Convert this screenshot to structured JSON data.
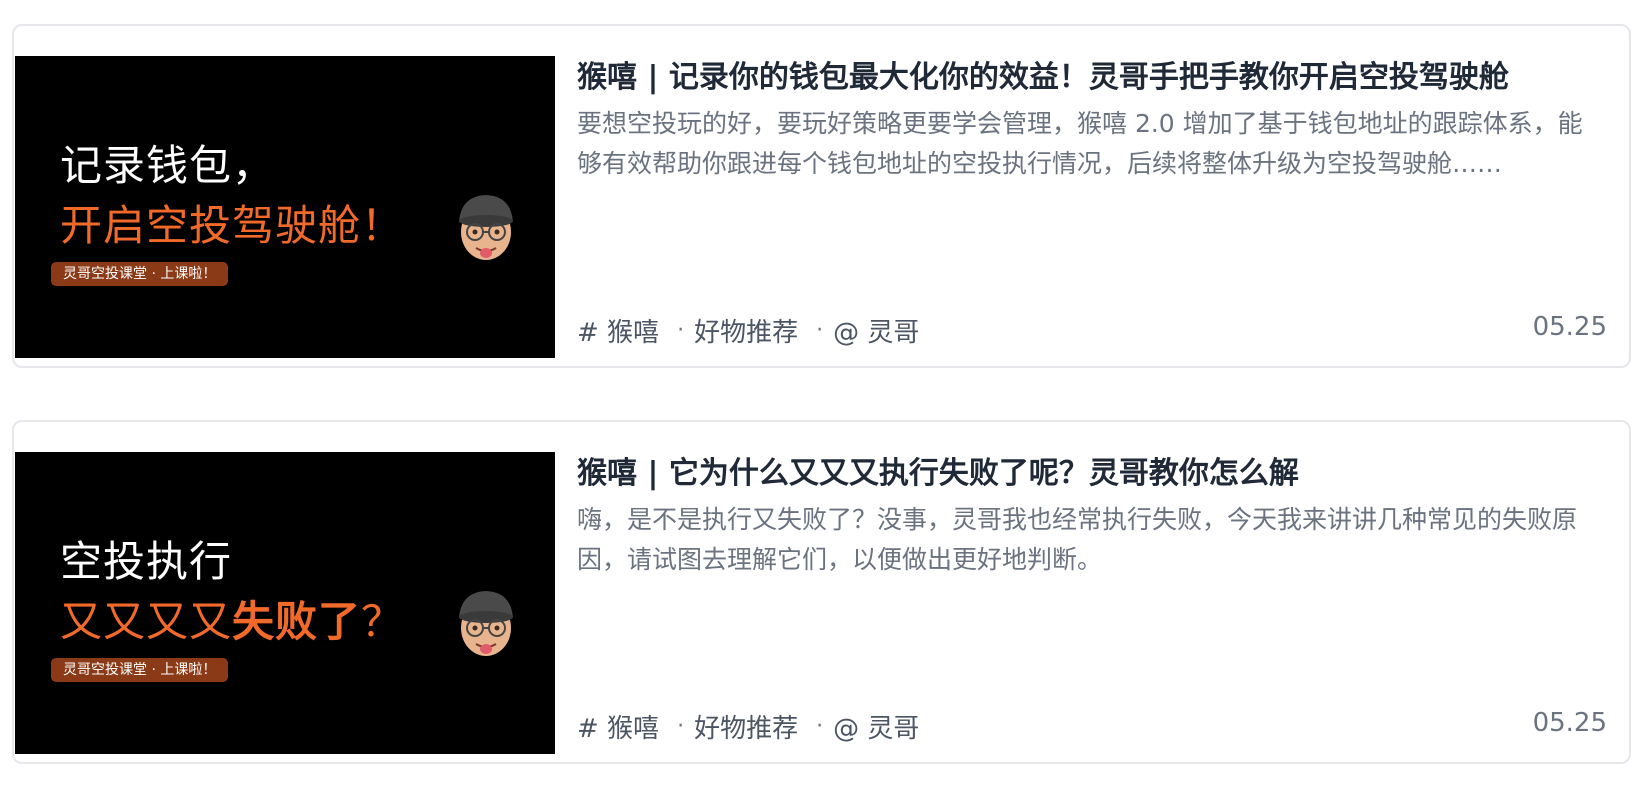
{
  "articles": [
    {
      "thumbnail": {
        "line1": "记录钱包，",
        "line2": "开启空投驾驶舱！",
        "pill": "灵哥空投课堂 · 上课啦！"
      },
      "title": "猴嘻 | 记录你的钱包最大化你的效益！灵哥手把手教你开启空投驾驶舱",
      "summary": "要想空投玩的好，要玩好策略更要学会管理，猴嘻 2.0 增加了基于钱包地址的跟踪体系，能够有效帮助你跟进每个钱包地址的空投执行情况，后续将整体升级为空投驾驶舱……",
      "tag": "# 猴嘻",
      "category": "好物推荐",
      "author": "@ 灵哥",
      "date": "05.25"
    },
    {
      "thumbnail": {
        "line1": "空投执行",
        "line2_a": "又又又又",
        "line2_b": "失败了",
        "line2_c": "？",
        "pill": "灵哥空投课堂 · 上课啦！"
      },
      "title": "猴嘻 | 它为什么又又又执行失败了呢？灵哥教你怎么解",
      "summary": "嗨，是不是执行又失败了？没事，灵哥我也经常执行失败，今天我来讲讲几种常见的失败原因，请试图去理解它们，以便做出更好地判断。",
      "tag": "# 猴嘻",
      "category": "好物推荐",
      "author": "@ 灵哥",
      "date": "05.25"
    }
  ],
  "meta_separator": "·"
}
